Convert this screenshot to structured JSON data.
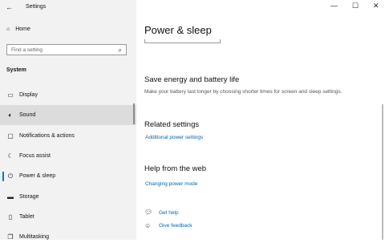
{
  "titlebar": {
    "back_icon": "back-arrow-icon",
    "title": "Settings",
    "minimize": "—",
    "maximize": "☐",
    "close": "✕"
  },
  "sidebar": {
    "home_label": "Home",
    "search_placeholder": "Find a setting",
    "section": "System",
    "items": [
      {
        "label": "Display",
        "icon": "display-icon"
      },
      {
        "label": "Sound",
        "icon": "speaker-icon"
      },
      {
        "label": "Notifications & actions",
        "icon": "notifications-icon"
      },
      {
        "label": "Focus assist",
        "icon": "moon-icon"
      },
      {
        "label": "Power & sleep",
        "icon": "power-icon"
      },
      {
        "label": "Storage",
        "icon": "storage-icon"
      },
      {
        "label": "Tablet",
        "icon": "tablet-icon"
      },
      {
        "label": "Multitasking",
        "icon": "multitasking-icon"
      }
    ],
    "selected_index": 1
  },
  "main": {
    "page_title": "Power & sleep",
    "save_energy": {
      "title": "Save energy and battery life",
      "desc": "Make your battery last longer by choosing shorter times for screen and sleep settings."
    },
    "related": {
      "title": "Related settings",
      "link": "Additional power settings"
    },
    "web": {
      "title": "Help from the web",
      "link": "Changing power mode"
    },
    "get_help": "Get help",
    "give_feedback": "Give feedback"
  },
  "colors": {
    "accent": "#0078d7",
    "link": "#0066b4",
    "sidebar_bg": "#f2f2f2"
  }
}
